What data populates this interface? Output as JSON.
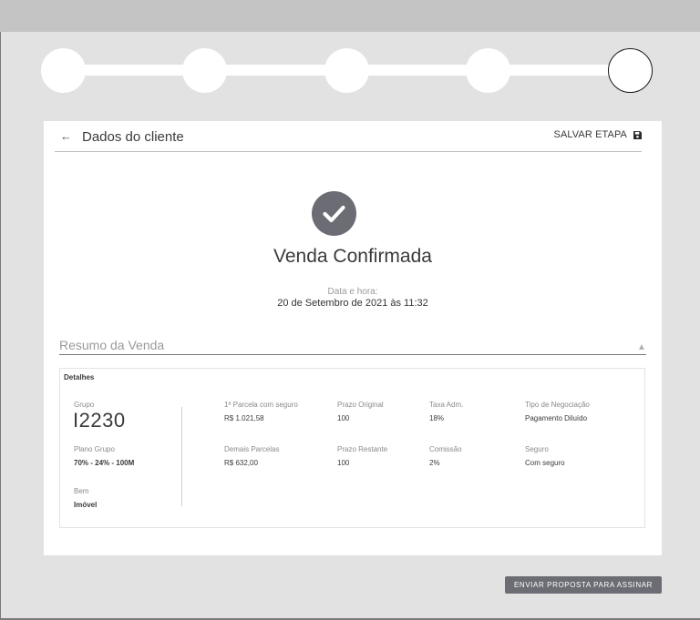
{
  "stepper": {
    "steps": 5,
    "current_step": 5
  },
  "header": {
    "back_icon": "arrow-left-icon",
    "title": "Dados do cliente",
    "save_label": "SALVAR ETAPA",
    "save_icon": "floppy-disk-icon"
  },
  "confirmation": {
    "icon": "check-circle-icon",
    "title": "Venda Confirmada",
    "date_label": "Data e hora:",
    "date_value": "20 de Setembro de 2021 às 11:32"
  },
  "summary": {
    "title": "Resumo da Venda",
    "toggle_icon": "triangle-up-icon",
    "details_label": "Detalhes",
    "grupo": {
      "label": "Grupo",
      "value": "I2230"
    },
    "plano_grupo": {
      "label": "Plano Grupo",
      "value": "70% - 24% - 100M"
    },
    "bem": {
      "label": "Bem",
      "value": "Imóvel"
    },
    "fields": [
      {
        "label": "1ª Parcela com seguro",
        "value": "R$ 1.021,58"
      },
      {
        "label": "Prazo Original",
        "value": "100"
      },
      {
        "label": "Taxa Adm.",
        "value": "18%"
      },
      {
        "label": "Tipo de Negociação",
        "value": "Pagamento Diluído"
      },
      {
        "label": "Demais Parcelas",
        "value": "R$ 632,00"
      },
      {
        "label": "Prazo Restante",
        "value": "100"
      },
      {
        "label": "Comissão",
        "value": "2%"
      },
      {
        "label": "Seguro",
        "value": "Com seguro"
      }
    ]
  },
  "actions": {
    "send_label": "ENVIAR PROPOSTA PARA ASSINAR"
  },
  "colors": {
    "background": "#e2e2e2",
    "topbar": "#c4c4c4",
    "accent": "#6c6c74",
    "card": "#ffffff"
  }
}
